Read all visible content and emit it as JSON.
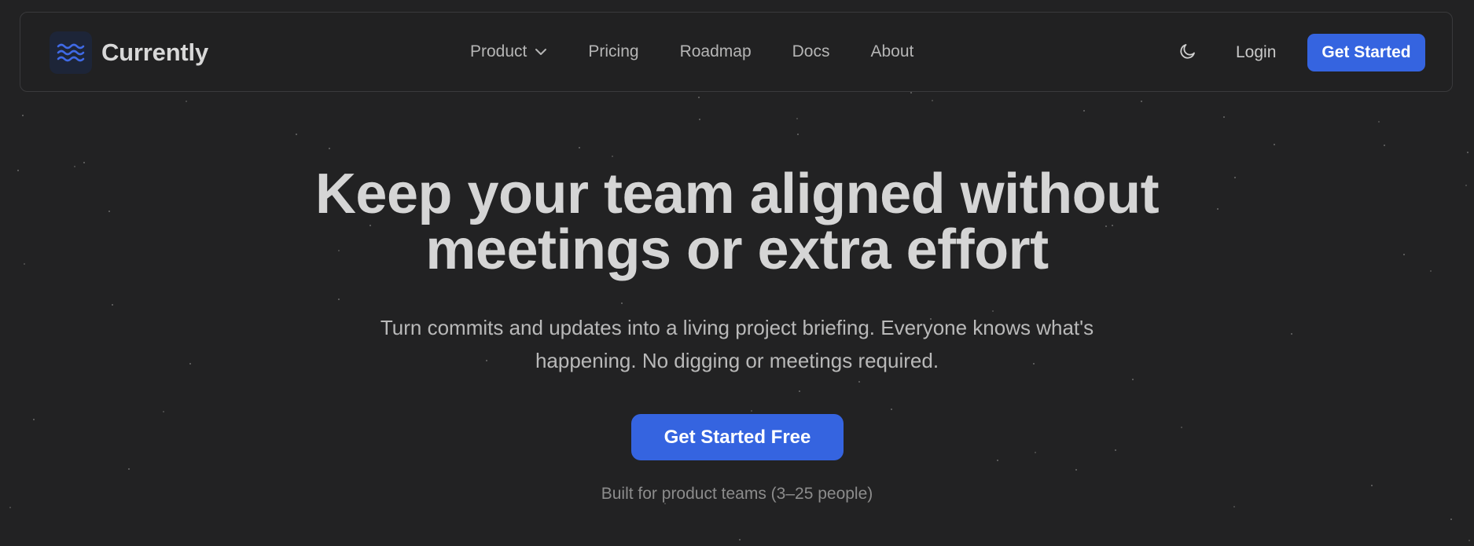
{
  "brand": {
    "name": "Currently",
    "logo_icon": "waves-icon"
  },
  "nav": {
    "links": [
      {
        "label": "Product",
        "has_dropdown": true
      },
      {
        "label": "Pricing"
      },
      {
        "label": "Roadmap"
      },
      {
        "label": "Docs"
      },
      {
        "label": "About"
      }
    ],
    "theme_toggle_icon": "moon-icon",
    "login_label": "Login",
    "cta_label": "Get Started"
  },
  "hero": {
    "title_line1": "Keep your team aligned without",
    "title_line2": "meetings or extra effort",
    "subtitle_line1": "Turn commits and updates into a living project briefing. Everyone knows what's",
    "subtitle_line2": "happening. No digging or meetings required.",
    "cta_label": "Get Started Free",
    "note": "Built for product teams (3–25 people)"
  },
  "colors": {
    "background": "#222223",
    "accent": "#3564e0",
    "text_primary": "#d5d5d5",
    "text_secondary": "#b9b9b9",
    "text_muted": "#8c8c8c"
  }
}
